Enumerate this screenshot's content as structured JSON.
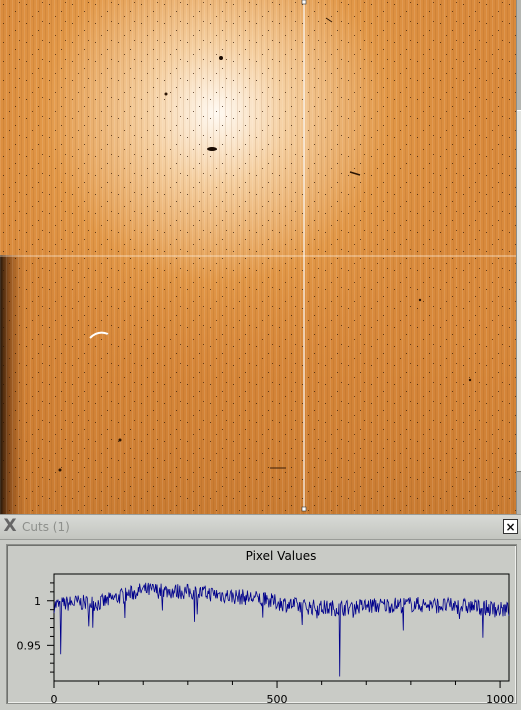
{
  "cuts_window": {
    "icon": "x-window-icon",
    "title": "Cuts (1)",
    "close_label": "×"
  },
  "chart_data": {
    "type": "line",
    "title": "Pixel Values",
    "xlabel": "",
    "ylabel": "",
    "xlim": [
      0,
      1020
    ],
    "ylim": [
      0.91,
      1.03
    ],
    "x_ticks": [
      0,
      500,
      1000
    ],
    "y_ticks": [
      1,
      0.95
    ],
    "line_color": "#00008b",
    "series": [
      {
        "x": [
          0,
          50,
          100,
          150,
          200,
          250,
          300,
          350,
          400,
          450,
          500,
          550,
          600,
          650,
          700,
          750,
          800,
          850,
          900,
          950,
          1000
        ],
        "values": [
          0.995,
          0.998,
          0.997,
          1.005,
          1.012,
          1.011,
          1.01,
          1.008,
          1.005,
          1.003,
          0.998,
          0.994,
          0.992,
          0.992,
          0.994,
          0.995,
          0.996,
          0.995,
          0.994,
          0.993,
          0.99
        ]
      }
    ]
  },
  "colors": {
    "image_base": "#d98a3c",
    "image_highlight": "#fdf5ec",
    "crosshair": "#ffffff"
  }
}
